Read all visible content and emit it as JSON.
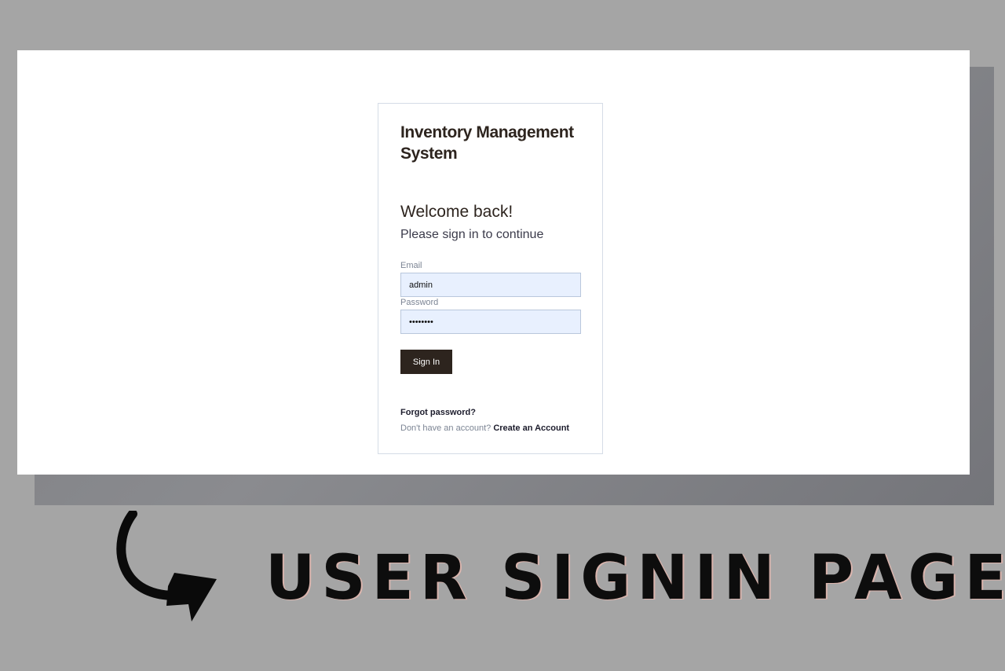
{
  "login": {
    "app_title": "Inventory Management System",
    "welcome_heading": "Welcome back!",
    "subtitle": "Please sign in to continue",
    "email_label": "Email",
    "email_value": "admin",
    "password_label": "Password",
    "password_value": "••••••••",
    "sign_in_label": "Sign In",
    "forgot_password": "Forgot password?",
    "signup_prompt": "Don't have an account?",
    "create_account": "Create an Account"
  },
  "caption": {
    "text": "USER SIGNIN PAGE",
    "arrow_icon": "curved-arrow-icon"
  },
  "colors": {
    "page_background": "#a5a5a5",
    "shadow_panel": "#7f8084",
    "primary_button": "#2d241e",
    "input_background": "#e8f0fe",
    "card_border": "#d5dce6"
  }
}
